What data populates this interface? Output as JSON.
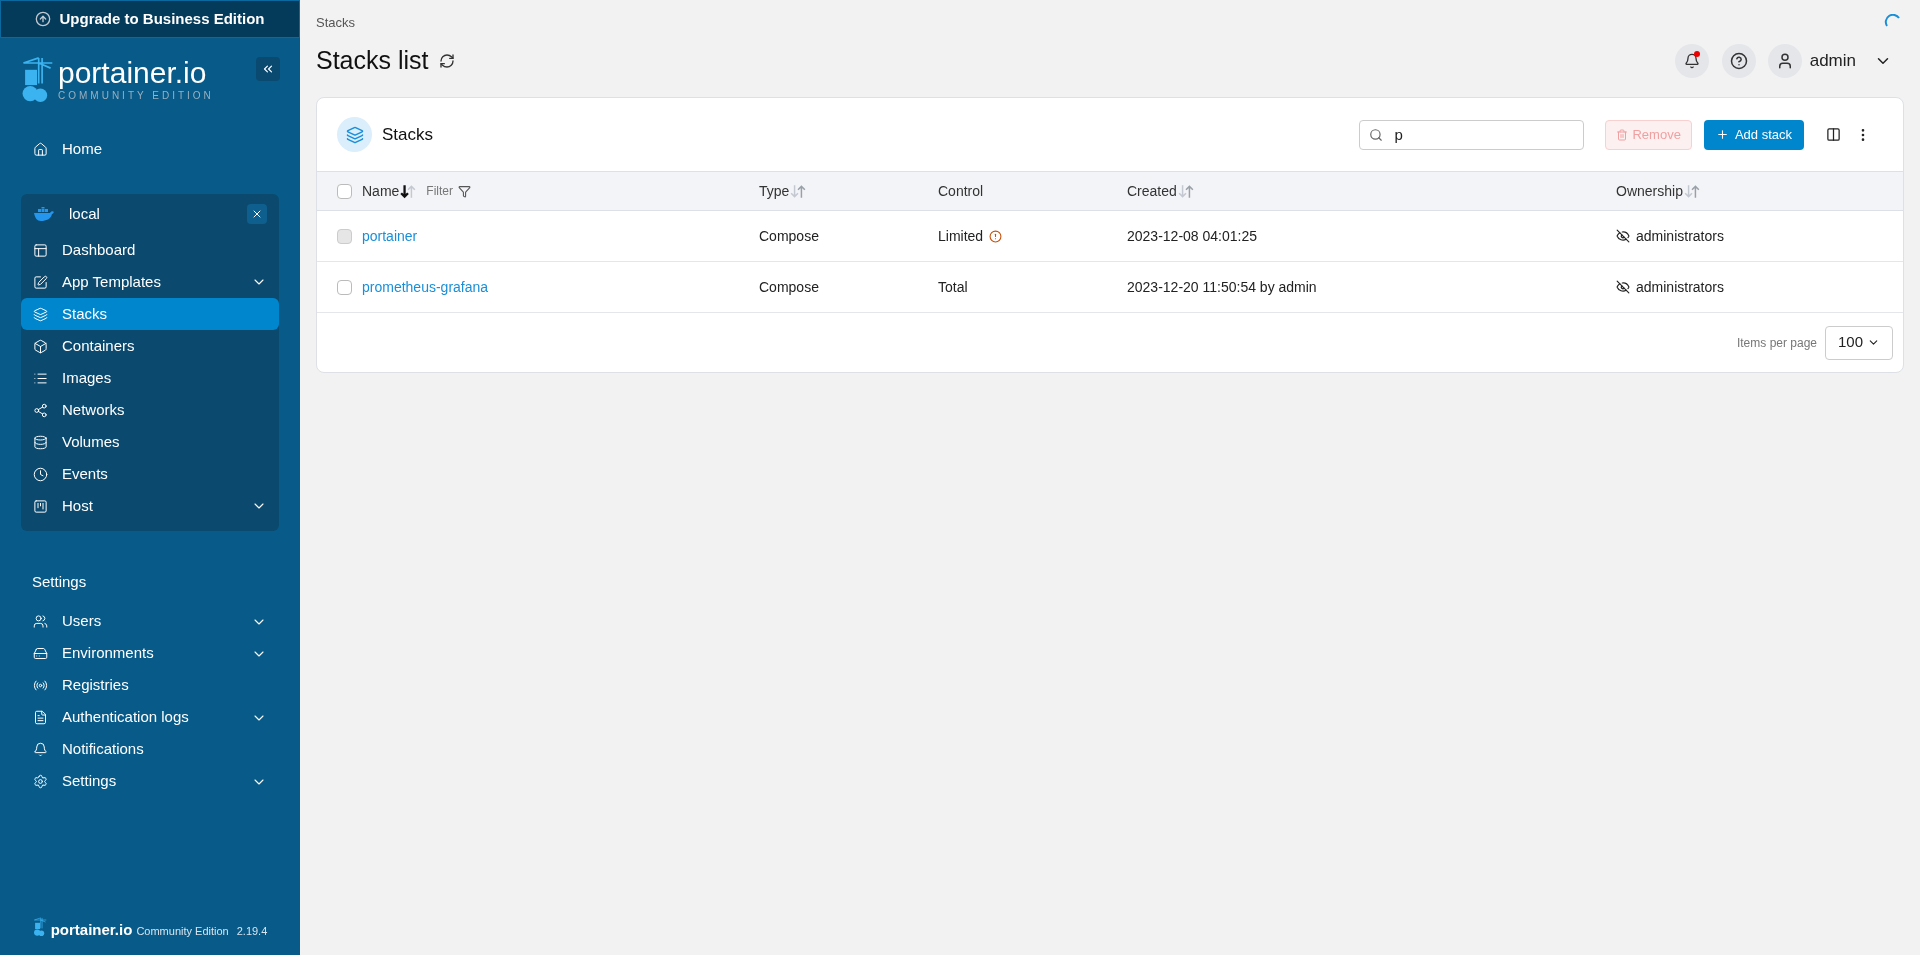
{
  "upgrade_banner": {
    "label": "Upgrade to Business Edition"
  },
  "logo": {
    "name": "portainer.io",
    "edition": "COMMUNITY EDITION"
  },
  "sidebar": {
    "home": {
      "label": "Home",
      "expandable": false,
      "selected": false
    },
    "environment": {
      "name": "local",
      "items": [
        {
          "label": "Dashboard",
          "expandable": false,
          "selected": false
        },
        {
          "label": "App Templates",
          "expandable": true,
          "selected": false
        },
        {
          "label": "Stacks",
          "expandable": false,
          "selected": true
        },
        {
          "label": "Containers",
          "expandable": false,
          "selected": false
        },
        {
          "label": "Images",
          "expandable": false,
          "selected": false
        },
        {
          "label": "Networks",
          "expandable": false,
          "selected": false
        },
        {
          "label": "Volumes",
          "expandable": false,
          "selected": false
        },
        {
          "label": "Events",
          "expandable": false,
          "selected": false
        },
        {
          "label": "Host",
          "expandable": true,
          "selected": false
        }
      ]
    },
    "settings_heading": "Settings",
    "settings_items": [
      {
        "label": "Users",
        "expandable": true,
        "selected": false
      },
      {
        "label": "Environments",
        "expandable": true,
        "selected": false
      },
      {
        "label": "Registries",
        "expandable": false,
        "selected": false
      },
      {
        "label": "Authentication logs",
        "expandable": true,
        "selected": false
      },
      {
        "label": "Notifications",
        "expandable": false,
        "selected": false
      },
      {
        "label": "Settings",
        "expandable": true,
        "selected": false
      }
    ],
    "footer": {
      "name": "portainer.io",
      "edition": "Community Edition",
      "version": "2.19.4"
    }
  },
  "header": {
    "breadcrumb": "Stacks",
    "title": "Stacks list",
    "notification_unread": true,
    "user": "admin"
  },
  "card": {
    "title": "Stacks",
    "search": {
      "value": "p"
    },
    "remove_button": {
      "label": "Remove",
      "disabled": true
    },
    "add_button": {
      "label": "Add stack"
    },
    "columns": [
      {
        "label": "Name",
        "sortable": true,
        "sorted_descending": true,
        "filter": "Filter"
      },
      {
        "label": "Type",
        "sortable": true,
        "sorted_descending": false
      },
      {
        "label": "Control",
        "sortable": false
      },
      {
        "label": "Created",
        "sortable": true,
        "sorted_descending": false
      },
      {
        "label": "Ownership",
        "sortable": true,
        "sorted_descending": false
      }
    ],
    "select_all": {
      "checked": false
    },
    "rows": [
      {
        "checked": false,
        "disabled": true,
        "name": "portainer",
        "type": "Compose",
        "control": "Limited",
        "control_warning": true,
        "created": "2023-12-08 04:01:25",
        "ownership": "administrators"
      },
      {
        "checked": false,
        "disabled": false,
        "name": "prometheus-grafana",
        "type": "Compose",
        "control": "Total",
        "control_warning": false,
        "created": "2023-12-20 11:50:54 by admin",
        "ownership": "administrators"
      }
    ],
    "pagination": {
      "label": "Items per page",
      "value": "100"
    }
  }
}
